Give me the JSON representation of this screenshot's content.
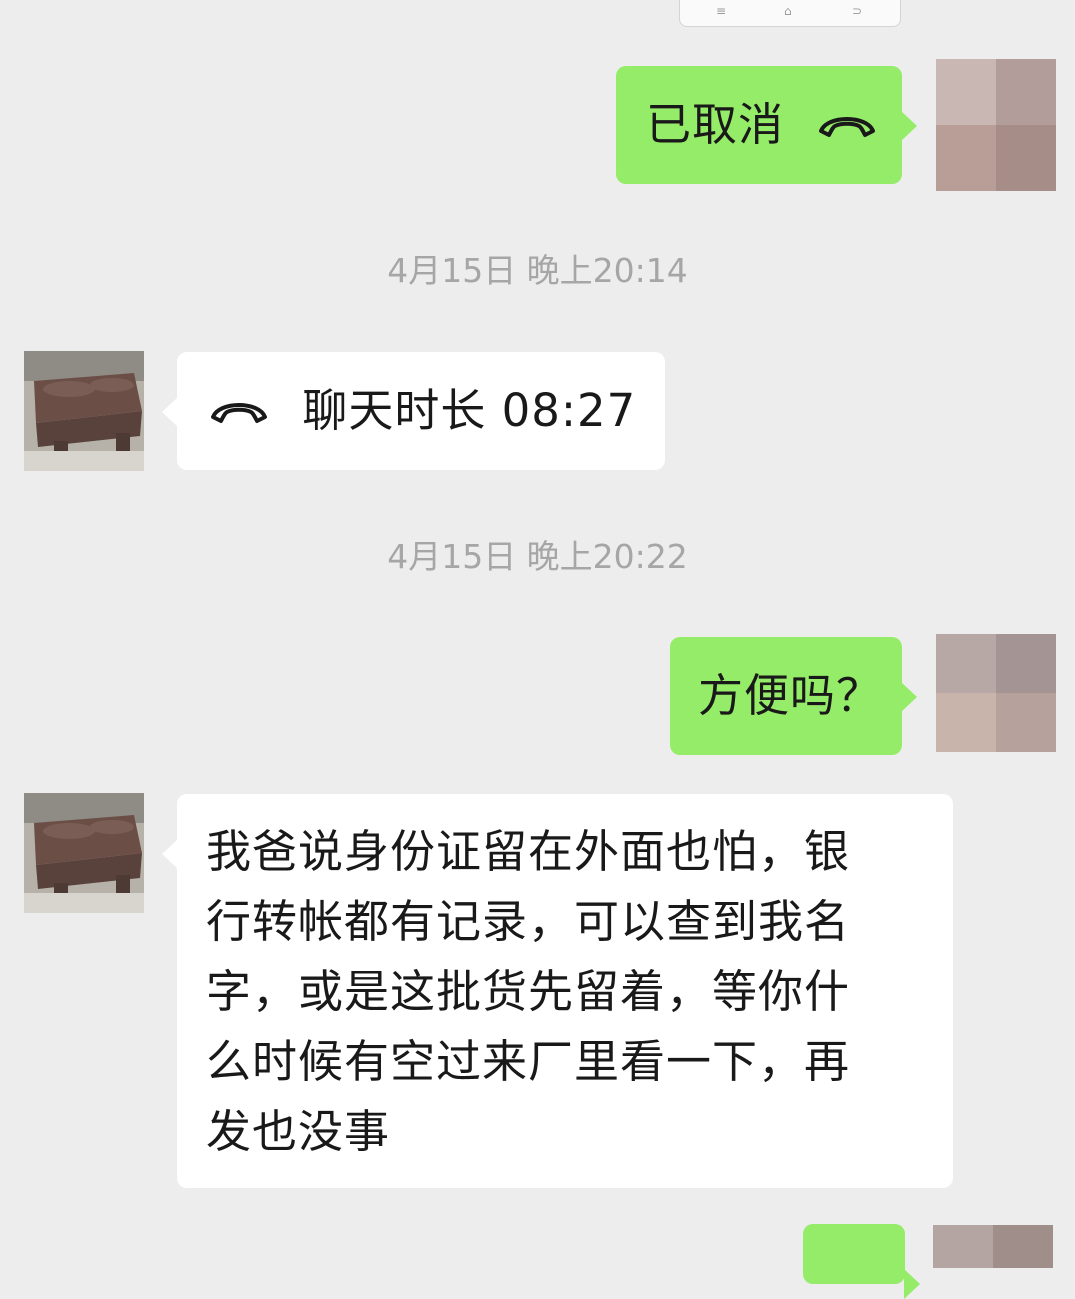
{
  "top_toolbar": {
    "icons": [
      "menu-icon",
      "home-icon",
      "back-icon"
    ],
    "glyphs": [
      "≡",
      "⌂",
      "⊃"
    ]
  },
  "messages": [
    {
      "side": "right",
      "type": "call",
      "text": "已取消",
      "icon": "phone-hangup-icon"
    },
    {
      "type": "timestamp",
      "text": "4月15日 晚上20:14"
    },
    {
      "side": "left",
      "type": "call",
      "text": "聊天时长 08:27",
      "icon": "phone-hangup-icon"
    },
    {
      "type": "timestamp",
      "text": "4月15日 晚上20:22"
    },
    {
      "side": "right",
      "type": "text",
      "text": "方便吗？"
    },
    {
      "side": "left",
      "type": "text",
      "lines": [
        "我爸说身份证留在外面也怕，银",
        "行转帐都有记录，可以查到我名",
        "字，或是这批货先留着，等你什",
        "么时候有空过来厂里看一下，再",
        "发也没事"
      ]
    },
    {
      "side": "right",
      "type": "text",
      "text": "",
      "note": "partially visible at bottom"
    }
  ],
  "colors": {
    "background": "#ededed",
    "self_bubble": "#95ec69",
    "other_bubble": "#ffffff",
    "timestamp_text": "#a6a6a6"
  }
}
